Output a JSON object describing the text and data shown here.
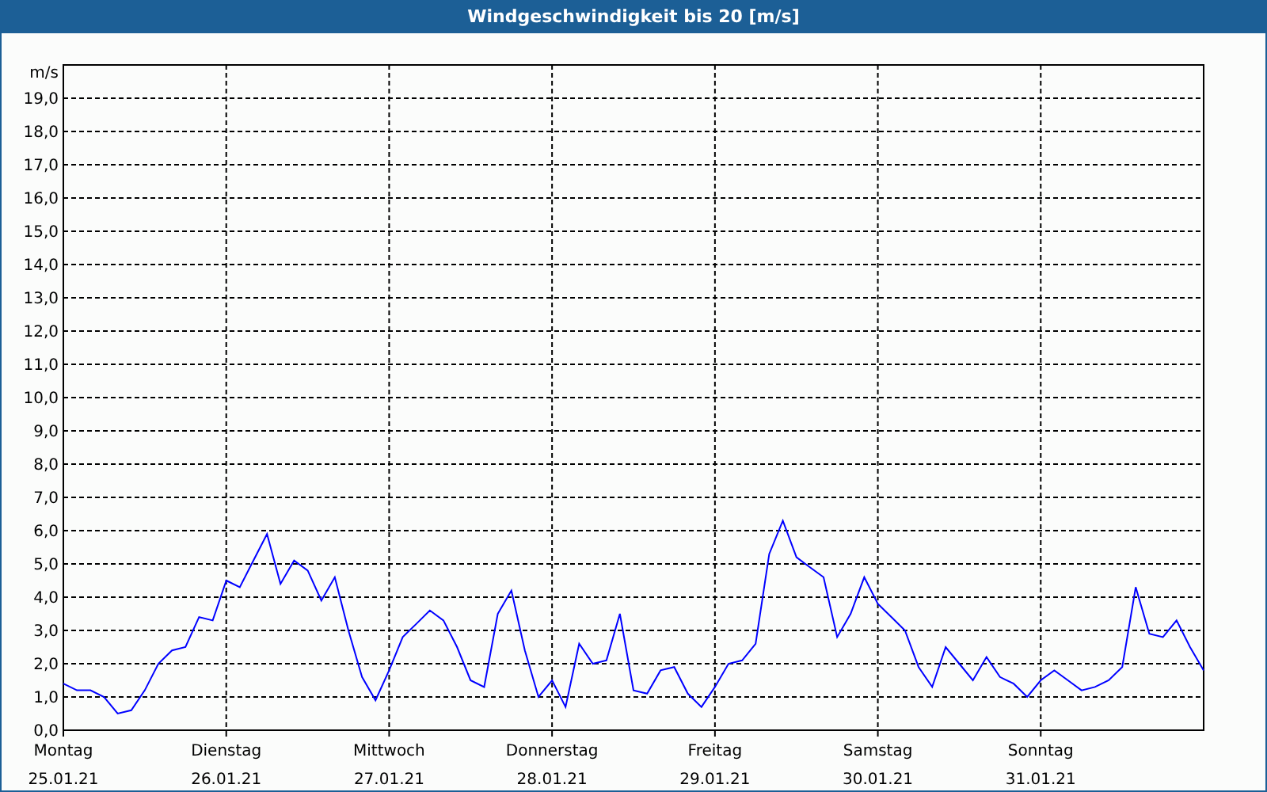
{
  "window": {
    "title": "Windgeschwindigkeit bis 20 [m/s]"
  },
  "chart": {
    "xtick_dates": [
      "25.01.21",
      "26.01.21",
      "27.01.21",
      "28.01.21",
      "29.01.21",
      "30.01.21",
      "31.01.21"
    ],
    "chart_data": {
      "type": "line",
      "grid": true,
      "ylabel": "m/s",
      "ylim": [
        0,
        20
      ],
      "categories": [
        "Montag",
        null,
        null,
        null,
        null,
        null,
        null,
        null,
        null,
        null,
        null,
        null,
        "Dienstag",
        null,
        null,
        null,
        null,
        null,
        null,
        null,
        null,
        null,
        null,
        null,
        "Mittwoch",
        null,
        null,
        null,
        null,
        null,
        null,
        null,
        null,
        null,
        null,
        null,
        "Donnerstag",
        null,
        null,
        null,
        null,
        null,
        null,
        null,
        null,
        null,
        null,
        null,
        "Freitag",
        null,
        null,
        null,
        null,
        null,
        null,
        null,
        null,
        null,
        null,
        null,
        "Samstag",
        null,
        null,
        null,
        null,
        null,
        null,
        null,
        null,
        null,
        null,
        null,
        "Sonntag",
        null,
        null,
        null,
        null,
        null,
        null,
        null,
        null,
        null,
        null,
        null,
        null
      ],
      "yticks": [
        {
          "value": 0,
          "label": "0,0"
        },
        {
          "value": 1,
          "label": "1,0"
        },
        {
          "value": 2,
          "label": "2,0"
        },
        {
          "value": 3,
          "label": "3,0"
        },
        {
          "value": 4,
          "label": "4,0"
        },
        {
          "value": 5,
          "label": "5,0"
        },
        {
          "value": 6,
          "label": "6,0"
        },
        {
          "value": 7,
          "label": "7,0"
        },
        {
          "value": 8,
          "label": "8,0"
        },
        {
          "value": 9,
          "label": "9,0"
        },
        {
          "value": 10,
          "label": "10,0"
        },
        {
          "value": 11,
          "label": "11,0"
        },
        {
          "value": 12,
          "label": "12,0"
        },
        {
          "value": 13,
          "label": "13,0"
        },
        {
          "value": 14,
          "label": "14,0"
        },
        {
          "value": 15,
          "label": "15,0"
        },
        {
          "value": 16,
          "label": "16,0"
        },
        {
          "value": 17,
          "label": "17,0"
        },
        {
          "value": 18,
          "label": "18,0"
        },
        {
          "value": 19,
          "label": "19,0"
        }
      ],
      "series": [
        {
          "color": "#0000ff",
          "values": [
            1.4,
            1.2,
            1.2,
            1.0,
            0.5,
            0.6,
            1.2,
            2.0,
            2.4,
            2.5,
            3.4,
            3.3,
            4.5,
            4.3,
            5.1,
            5.9,
            4.4,
            5.1,
            4.8,
            3.9,
            4.6,
            3.0,
            1.6,
            0.9,
            1.8,
            2.8,
            3.2,
            3.6,
            3.3,
            2.5,
            1.5,
            1.3,
            3.5,
            4.2,
            2.4,
            1.0,
            1.5,
            0.7,
            2.6,
            2.0,
            2.1,
            3.5,
            1.2,
            1.1,
            1.8,
            1.9,
            1.1,
            0.7,
            1.3,
            2.0,
            2.1,
            2.6,
            5.3,
            6.3,
            5.2,
            4.9,
            4.6,
            2.8,
            3.5,
            4.6,
            3.8,
            3.4,
            3.0,
            1.9,
            1.3,
            2.5,
            2.0,
            1.5,
            2.2,
            1.6,
            1.4,
            1.0,
            1.5,
            1.8,
            1.5,
            1.2,
            1.3,
            1.5,
            1.9,
            4.3,
            2.9,
            2.8,
            3.3,
            2.5,
            1.8
          ]
        }
      ]
    }
  }
}
